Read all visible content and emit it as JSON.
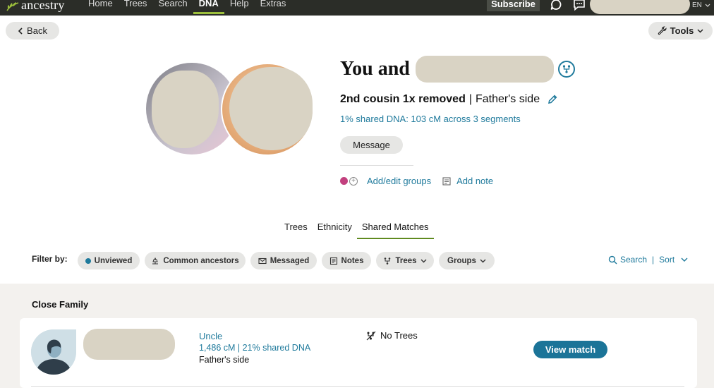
{
  "nav": {
    "logo": "ancestry",
    "links": [
      "Home",
      "Trees",
      "Search",
      "DNA",
      "Help",
      "Extras"
    ],
    "active": "DNA",
    "subscribe": "Subscribe",
    "language": "EN"
  },
  "toolbar": {
    "back_label": "Back",
    "tools_label": "Tools"
  },
  "profile": {
    "title_prefix": "You and",
    "relationship": "2nd cousin 1x removed",
    "separator": "|",
    "side": "Father's side",
    "shared_dna": "1% shared DNA: 103 cM across 3 segments",
    "message_label": "Message",
    "groups_label": "Add/edit groups",
    "note_label": "Add note",
    "group_color": "#c2407e"
  },
  "tabs": {
    "items": [
      "Trees",
      "Ethnicity",
      "Shared Matches"
    ],
    "active": "Shared Matches"
  },
  "filters": {
    "label": "Filter by:",
    "chips": [
      "Unviewed",
      "Common ancestors",
      "Messaged",
      "Notes",
      "Trees",
      "Groups"
    ],
    "search_label": "Search",
    "sort_label": "Sort"
  },
  "section": {
    "title": "Close Family",
    "matches": [
      {
        "relationship": "Uncle",
        "cm": "1,486 cM | 21% shared DNA",
        "side": "Father's side",
        "trees": "No Trees",
        "action": "View match"
      }
    ]
  },
  "colors": {
    "accent_blue": "#1f7a9c",
    "brand_green": "#9cbf3c",
    "nav_bg": "#2b2d28"
  }
}
